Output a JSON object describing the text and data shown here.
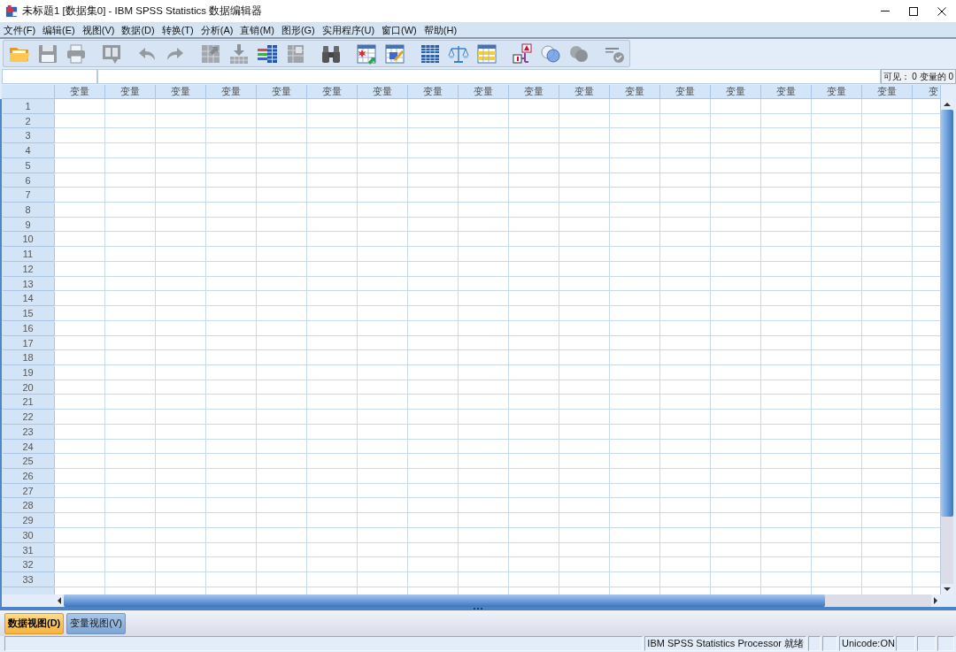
{
  "window": {
    "title": "未标题1 [数据集0] - IBM SPSS Statistics 数据编辑器"
  },
  "menu": [
    "文件(F)",
    "编辑(E)",
    "视图(V)",
    "数据(D)",
    "转换(T)",
    "分析(A)",
    "直销(M)",
    "图形(G)",
    "实用程序(U)",
    "窗口(W)",
    "帮助(H)"
  ],
  "toolbar": {
    "groups": [
      {
        "items": [
          {
            "kind": "open",
            "disabled": false
          },
          {
            "kind": "save",
            "disabled": true
          },
          {
            "kind": "print",
            "disabled": true
          }
        ]
      },
      {
        "items": [
          {
            "kind": "recall",
            "disabled": true
          }
        ]
      },
      {
        "items": [
          {
            "kind": "undo",
            "disabled": true
          },
          {
            "kind": "redo",
            "disabled": true
          }
        ]
      },
      {
        "items": [
          {
            "kind": "gotocase",
            "disabled": true
          },
          {
            "kind": "gotovariable",
            "disabled": true
          },
          {
            "kind": "variables",
            "disabled": false
          },
          {
            "kind": "descriptives",
            "disabled": true
          }
        ]
      },
      {
        "items": [
          {
            "kind": "find",
            "disabled": false
          }
        ]
      },
      {
        "items": [
          {
            "kind": "insertcases",
            "disabled": false
          },
          {
            "kind": "insertvariable",
            "disabled": false
          }
        ]
      },
      {
        "items": [
          {
            "kind": "split",
            "disabled": false
          },
          {
            "kind": "weight",
            "disabled": false
          },
          {
            "kind": "select",
            "disabled": false
          }
        ]
      },
      {
        "items": [
          {
            "kind": "valuelabels",
            "disabled": false
          },
          {
            "kind": "sets",
            "disabled": false
          },
          {
            "kind": "showall",
            "disabled": true
          }
        ]
      },
      {
        "items": [
          {
            "kind": "spelling",
            "disabled": true
          }
        ]
      }
    ]
  },
  "cell_bar": {
    "visible_count": "可见： 0 变量的 0"
  },
  "grid": {
    "columns": [
      "变量",
      "变量",
      "变量",
      "变量",
      "变量",
      "变量",
      "变量",
      "变量",
      "变量",
      "变量",
      "变量",
      "变量",
      "变量",
      "变量",
      "变量",
      "变量",
      "变量",
      "变"
    ],
    "rows": [
      "1",
      "2",
      "3",
      "4",
      "5",
      "6",
      "7",
      "8",
      "9",
      "10",
      "11",
      "12",
      "13",
      "14",
      "15",
      "16",
      "17",
      "18",
      "19",
      "20",
      "21",
      "22",
      "23",
      "24",
      "25",
      "26",
      "27",
      "28",
      "29",
      "30",
      "31",
      "32",
      "33"
    ]
  },
  "tabs": [
    {
      "label": "数据视图(D)",
      "selected": true
    },
    {
      "label": "变量视图(V)",
      "selected": false
    }
  ],
  "status_bar": {
    "processor": "IBM SPSS Statistics Processor 就绪",
    "encoding": "Unicode:ON"
  }
}
